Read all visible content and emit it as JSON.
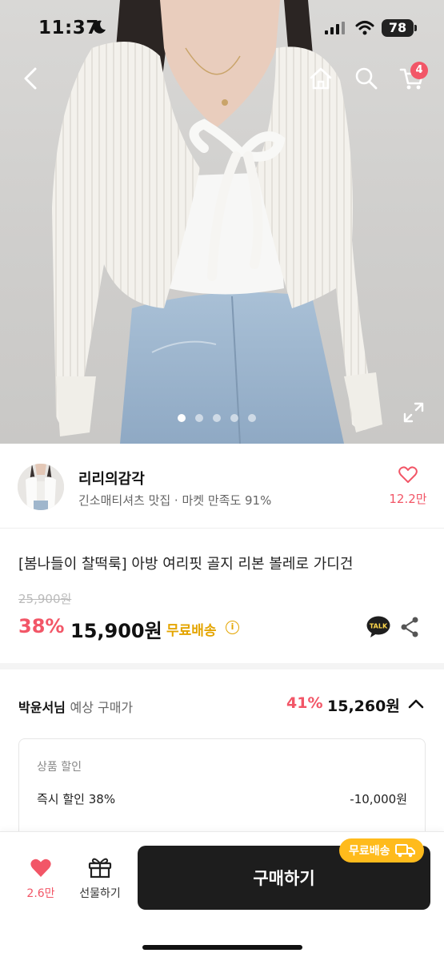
{
  "status_bar": {
    "time": "11:37",
    "battery": "78"
  },
  "topnav": {
    "cart_count": "4"
  },
  "gallery": {
    "pages": 5,
    "active": 0
  },
  "seller": {
    "name": "리리의감각",
    "description": "긴소매티셔츠 맛집 · 마켓 만족도 91%",
    "like_count": "12.2만"
  },
  "product": {
    "title": "[봄나들이 찰떡룩] 아방 여리핏 골지 리본 볼레로 가디건",
    "original_price": "25,900원",
    "discount_rate": "38%",
    "price": "15,900원",
    "shipping": "무료배송",
    "talk_label": "TALK"
  },
  "member_price": {
    "name": "박윤서님",
    "label": "예상 구매가",
    "discount_rate": "41%",
    "price": "15,260원"
  },
  "discount_detail": {
    "header": "상품 할인",
    "items": [
      {
        "label": "즉시 할인 38%",
        "amount": "-10,000원"
      }
    ]
  },
  "bottom_bar": {
    "like_count": "2.6만",
    "gift_label": "선물하기",
    "buy_label": "구매하기",
    "free_shipping_badge": "무료배송"
  },
  "colors": {
    "accent": "#f25667",
    "shipping": "#e4a500",
    "badge": "#ffbb1c",
    "buy_button": "#1d1d1d"
  }
}
